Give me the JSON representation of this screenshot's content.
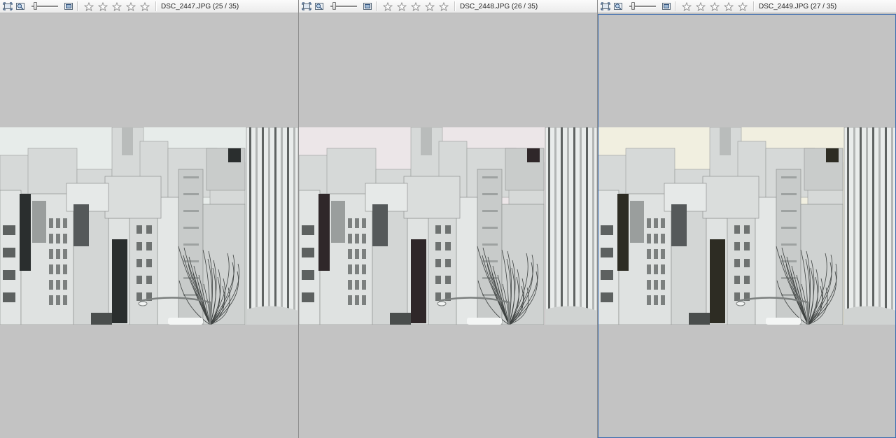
{
  "panes": [
    {
      "filename": "DSC_2447.JPG (25 / 35)",
      "slider_level": 0.1,
      "rating": 0,
      "active": false,
      "tint": "#e7ecea",
      "shade": "#2a2e2e"
    },
    {
      "filename": "DSC_2448.JPG (26 / 35)",
      "slider_level": 0.1,
      "rating": 0,
      "active": false,
      "tint": "#ece6e8",
      "shade": "#2f2729"
    },
    {
      "filename": "DSC_2449.JPG (27 / 35)",
      "slider_level": 0.1,
      "rating": 0,
      "active": true,
      "tint": "#f1efe0",
      "shade": "#2d2c23"
    }
  ],
  "icons": {
    "fit": "fit-to-window-icon",
    "zoom": "zoom-icon",
    "fullscreen": "fullscreen-icon",
    "star": "star-icon"
  },
  "colors": {
    "background": "#c3c3c3",
    "active_border": "#3b6cb0"
  }
}
